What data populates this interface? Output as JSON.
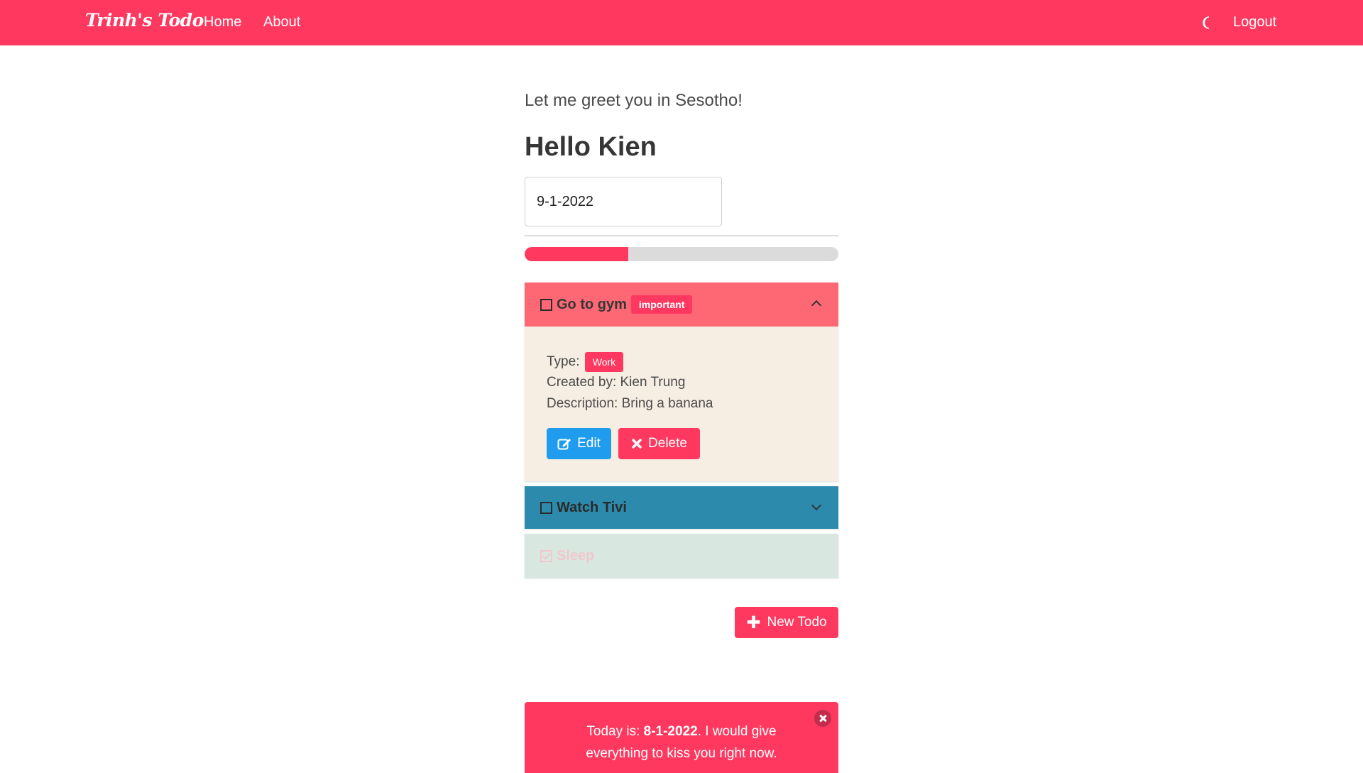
{
  "navbar": {
    "brand": "Trinh's Todo",
    "links": {
      "home": "Home",
      "about": "About",
      "logout": "Logout"
    },
    "moon_icon": "moon-icon",
    "color": "#ff3860"
  },
  "main": {
    "greeting": "Let me greet you in Sesotho!",
    "hello": "Hello Kien",
    "date_value": "9-1-2022",
    "progress_fraction": 0.33
  },
  "todos": [
    {
      "title": "Go to gym",
      "badge": "important",
      "expanded": true,
      "done": false,
      "color": "#fe6874",
      "type_label": "Type:",
      "type_value": "Work",
      "created_by": "Created by: Kien Trung",
      "description": "Description: Bring a banana",
      "edit_label": "Edit",
      "delete_label": "Delete"
    },
    {
      "title": "Watch Tivi",
      "expanded": false,
      "done": false,
      "color": "#2c8aad"
    },
    {
      "title": "Sleep",
      "expanded": false,
      "done": true,
      "color": "#d8e8e1"
    }
  ],
  "new_todo_label": "New Todo",
  "notification": {
    "prefix": "Today is: ",
    "date": "8-1-2022",
    "suffix": ". I would give everything to kiss you right now."
  }
}
